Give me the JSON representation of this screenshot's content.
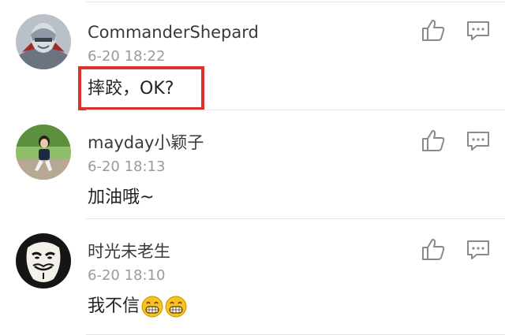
{
  "comments": [
    {
      "username": "CommanderShepard",
      "timestamp": "6-20 18:22",
      "content": "摔跤，OK?",
      "highlighted": true,
      "avatar_icon": "armored-soldier-avatar"
    },
    {
      "username": "mayday小颖子",
      "timestamp": "6-20 18:13",
      "content": "加油哦~",
      "highlighted": false,
      "avatar_icon": "girl-photo-avatar"
    },
    {
      "username": "时光未老生",
      "timestamp": "6-20 18:10",
      "content": "我不信",
      "emojis": [
        "grinning-face-emoji",
        "grinning-face-emoji"
      ],
      "highlighted": false,
      "avatar_icon": "guy-fawkes-mask-avatar"
    }
  ],
  "icons": {
    "like": "thumbs-up-icon",
    "reply": "comment-bubble-icon"
  },
  "colors": {
    "highlight_border": "#d9322e",
    "username": "#3a3a3a",
    "timestamp": "#9a9a9a",
    "icon_stroke": "#8a8a8a",
    "emoji_fill": "#f6c21f"
  }
}
